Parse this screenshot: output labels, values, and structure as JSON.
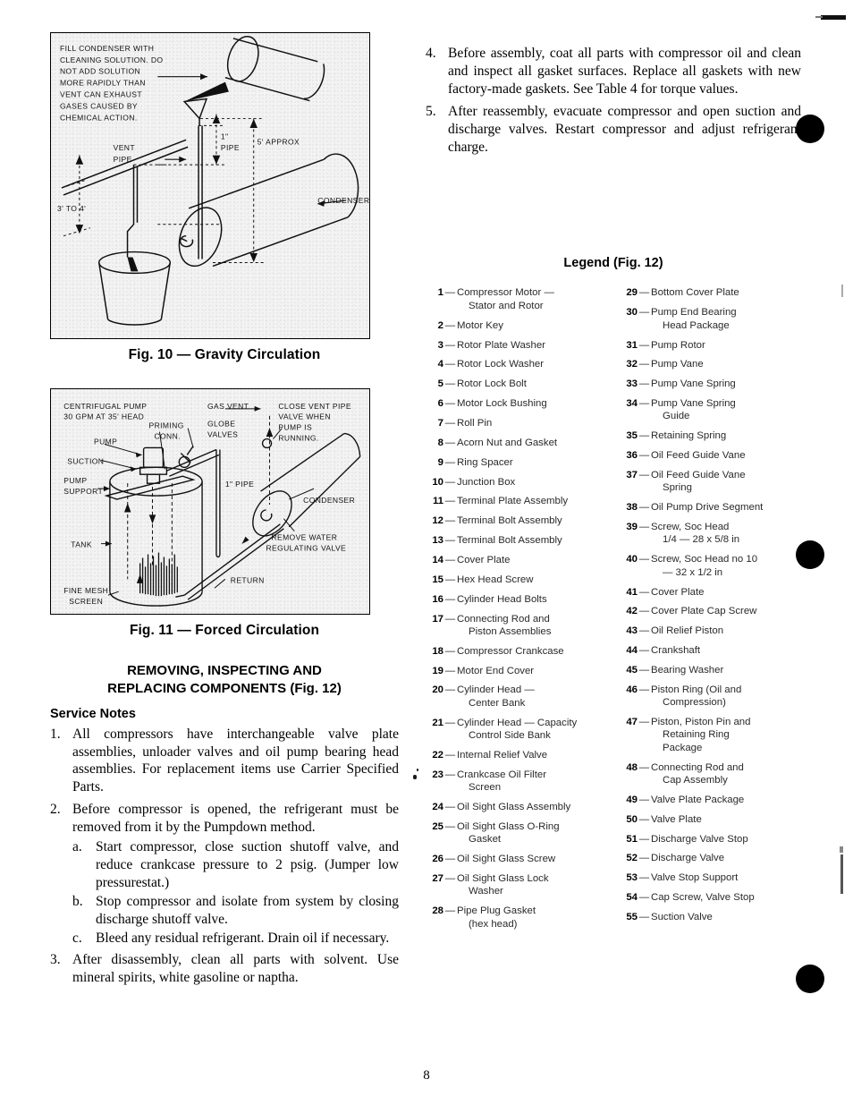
{
  "page": {
    "number": "8"
  },
  "figures": [
    {
      "id": "fig10",
      "caption": "Fig. 10 — Gravity Circulation",
      "callouts": [
        "FILL CONDENSER WITH",
        "CLEANING SOLUTION. DO",
        "NOT ADD SOLUTION",
        "MORE RAPIDLY THAN",
        "VENT CAN EXHAUST",
        "GASES CAUSED BY",
        "CHEMICAL ACTION.",
        "VENT",
        "PIPE",
        "1\" PIPE",
        "5' APPROX",
        "3' TO 4'",
        "CONDENSER"
      ]
    },
    {
      "id": "fig11",
      "caption": "Fig. 11 — Forced Circulation",
      "callouts": [
        "CENTRIFUGAL PUMP",
        "30 GPM AT 35' HEAD",
        "PUMP",
        "SUCTION",
        "PUMP",
        "SUPPORT",
        "PRIMING",
        "CONN.",
        "GLOBE",
        "VALVES",
        "GAS VENT",
        "CLOSE VENT PIPE",
        "VALVE WHEN",
        "PUMP IS",
        "RUNNING.",
        "1\" PIPE",
        "CONDENSER",
        "REMOVE WATER",
        "REGULATING VALVE",
        "TANK",
        "RETURN",
        "FINE MESH",
        "SCREEN"
      ]
    }
  ],
  "left_column": {
    "heading_line1": "REMOVING, INSPECTING AND",
    "heading_line2": "REPLACING COMPONENTS (Fig. 12)",
    "subhead": "Service Notes",
    "items": [
      {
        "marker": "1.",
        "text": "All compressors have interchangeable valve plate assemblies, unloader valves and oil pump bearing head assemblies. For replacement items use Carrier Specified Parts."
      },
      {
        "marker": "2.",
        "text": "Before compressor is opened, the refrigerant must be removed from it by the Pumpdown method.",
        "subitems": [
          {
            "marker": "a.",
            "text": "Start compressor, close suction shutoff valve, and reduce crankcase pressure to 2 psig. (Jumper low pressurestat.)"
          },
          {
            "marker": "b.",
            "text": "Stop compressor and isolate from system by closing discharge shutoff valve."
          },
          {
            "marker": "c.",
            "text": "Bleed any residual refrigerant. Drain oil if necessary."
          }
        ]
      },
      {
        "marker": "3.",
        "text": "After disassembly, clean all parts with solvent. Use mineral spirits, white gasoline or naptha."
      }
    ]
  },
  "right_column": {
    "items": [
      {
        "marker": "4.",
        "text": "Before assembly, coat all parts with compressor oil and clean and inspect all gasket surfaces. Replace all gaskets with new factory-made gaskets. See Table 4 for torque values."
      },
      {
        "marker": "5.",
        "text": "After reassembly, evacuate compressor and open suction and discharge valves. Restart compressor and adjust refrigerant charge."
      }
    ]
  },
  "legend": {
    "title": "Legend (Fig. 12)",
    "column_left": [
      {
        "num": "1",
        "text": "Compressor Motor —",
        "cont": "Stator and Rotor"
      },
      {
        "num": "2",
        "text": "Motor Key"
      },
      {
        "num": "3",
        "text": "Rotor Plate Washer"
      },
      {
        "num": "4",
        "text": "Rotor Lock Washer"
      },
      {
        "num": "5",
        "text": "Rotor Lock Bolt"
      },
      {
        "num": "6",
        "text": "Motor Lock Bushing"
      },
      {
        "num": "7",
        "text": "Roll Pin"
      },
      {
        "num": "8",
        "text": "Acorn Nut and Gasket"
      },
      {
        "num": "9",
        "text": "Ring Spacer"
      },
      {
        "num": "10",
        "text": "Junction Box"
      },
      {
        "num": "11",
        "text": "Terminal Plate Assembly"
      },
      {
        "num": "12",
        "text": "Terminal Bolt Assembly"
      },
      {
        "num": "13",
        "text": "Terminal Bolt Assembly"
      },
      {
        "num": "14",
        "text": "Cover Plate"
      },
      {
        "num": "15",
        "text": "Hex Head Screw"
      },
      {
        "num": "16",
        "text": "Cylinder Head Bolts"
      },
      {
        "num": "17",
        "text": "Connecting Rod and",
        "cont": "Piston Assemblies"
      },
      {
        "num": "18",
        "text": "Compressor Crankcase"
      },
      {
        "num": "19",
        "text": "Motor End Cover"
      },
      {
        "num": "20",
        "text": "Cylinder Head —",
        "cont": "Center Bank"
      },
      {
        "num": "21",
        "text": "Cylinder Head — Capacity",
        "cont": "Control Side Bank"
      },
      {
        "num": "22",
        "text": "Internal Relief Valve"
      },
      {
        "num": "23",
        "text": "Crankcase Oil Filter",
        "cont": "Screen"
      },
      {
        "num": "24",
        "text": "Oil Sight Glass Assembly"
      },
      {
        "num": "25",
        "text": "Oil Sight Glass O-Ring",
        "cont": "Gasket"
      },
      {
        "num": "26",
        "text": "Oil Sight Glass Screw"
      },
      {
        "num": "27",
        "text": "Oil Sight Glass Lock",
        "cont": "Washer"
      },
      {
        "num": "28",
        "text": "Pipe Plug Gasket",
        "cont": "(hex head)"
      }
    ],
    "column_right": [
      {
        "num": "29",
        "text": "Bottom Cover Plate"
      },
      {
        "num": "30",
        "text": "Pump End Bearing",
        "cont": "Head Package"
      },
      {
        "num": "31",
        "text": "Pump Rotor"
      },
      {
        "num": "32",
        "text": "Pump Vane"
      },
      {
        "num": "33",
        "text": "Pump Vane Spring"
      },
      {
        "num": "34",
        "text": "Pump Vane Spring",
        "cont": "Guide"
      },
      {
        "num": "35",
        "text": "Retaining Spring"
      },
      {
        "num": "36",
        "text": "Oil Feed Guide Vane"
      },
      {
        "num": "37",
        "text": "Oil Feed Guide Vane",
        "cont": "Spring"
      },
      {
        "num": "38",
        "text": "Oil Pump Drive Segment"
      },
      {
        "num": "39",
        "text": "Screw, Soc Head",
        "cont": "1/4 — 28 x 5/8 in"
      },
      {
        "num": "40",
        "text": "Screw, Soc Head no  10",
        "cont": "— 32 x 1/2 in"
      },
      {
        "num": "41",
        "text": "Cover Plate"
      },
      {
        "num": "42",
        "text": "Cover Plate Cap Screw"
      },
      {
        "num": "43",
        "text": "Oil Relief Piston"
      },
      {
        "num": "44",
        "text": "Crankshaft"
      },
      {
        "num": "45",
        "text": "Bearing Washer"
      },
      {
        "num": "46",
        "text": "Piston Ring (Oil and",
        "cont": "Compression)"
      },
      {
        "num": "47",
        "text": "Piston, Piston Pin and",
        "cont": "Retaining Ring",
        "cont2": "Package"
      },
      {
        "num": "48",
        "text": "Connecting Rod and",
        "cont": "Cap Assembly"
      },
      {
        "num": "49",
        "text": "Valve Plate Package"
      },
      {
        "num": "50",
        "text": "Valve Plate"
      },
      {
        "num": "51",
        "text": "Discharge Valve Stop"
      },
      {
        "num": "52",
        "text": "Discharge Valve"
      },
      {
        "num": "53",
        "text": "Valve Stop Support"
      },
      {
        "num": "54",
        "text": "Cap  Screw, Valve Stop"
      },
      {
        "num": "55",
        "text": "Suction Valve"
      }
    ]
  }
}
